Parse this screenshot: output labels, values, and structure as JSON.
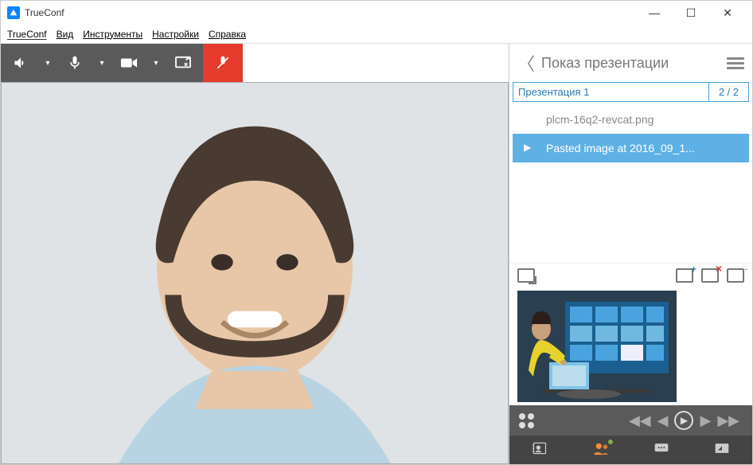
{
  "app": {
    "title": "TrueConf"
  },
  "menu": {
    "item0": "TrueConf",
    "item1": "Вид",
    "item2": "Инструменты",
    "item3": "Настройки",
    "item4": "Справка"
  },
  "toolbar": {
    "speaker": "speaker-icon",
    "mic": "mic-icon",
    "camera": "camera-icon",
    "share": "share-screen-icon",
    "hangup": "hangup-icon"
  },
  "panel": {
    "title": "Показ презентации"
  },
  "presentation": {
    "name": "Презентация 1",
    "counter": "2 / 2"
  },
  "files": {
    "item0": "plcm-16q2-revcat.png",
    "item1": "Pasted image at 2016_09_1..."
  },
  "colors": {
    "accent": "#5eb1e4",
    "toolbar": "#5a5a5a",
    "hangup": "#e43b2c"
  }
}
